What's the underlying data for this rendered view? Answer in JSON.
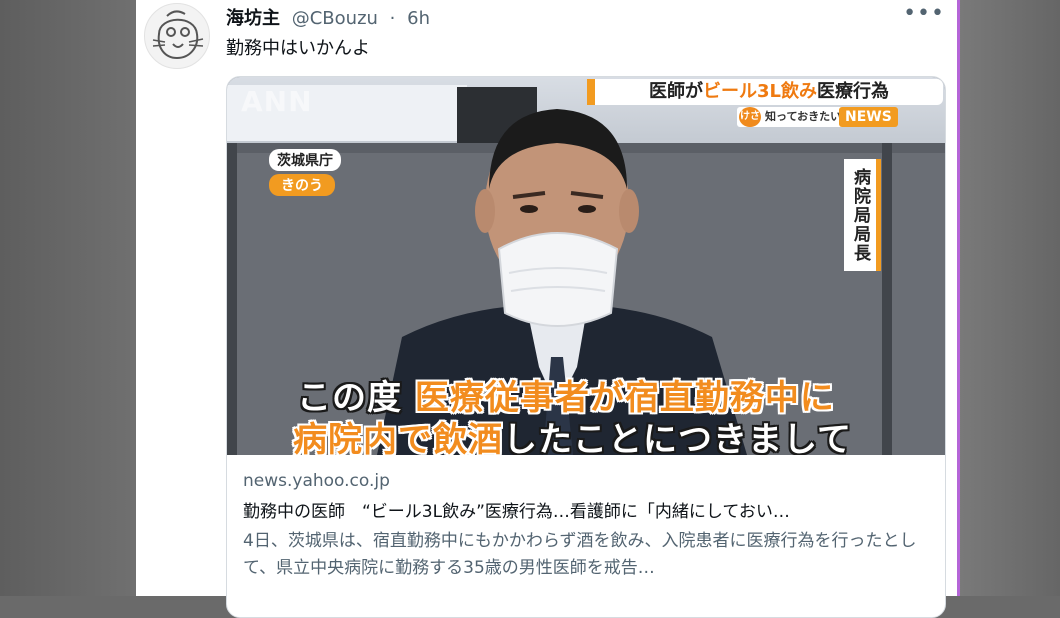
{
  "tweet": {
    "display_name": "海坊主",
    "handle": "@CBouzu",
    "separator": "·",
    "time": "6h",
    "more_label": "•••",
    "text": "勤務中はいかんよ"
  },
  "media": {
    "banner_prefix": "医師が",
    "banner_highlight": "ビール3L飲み",
    "banner_suffix": "医療行為",
    "show_logo_mark": "けさ",
    "show_logo_text": "知っておきたい!",
    "news_tag": "NEWS",
    "watermark": "ANN",
    "location": "茨城県庁",
    "when": "きのう",
    "role": "病院局局長",
    "caption_line1_white": "この度",
    "caption_line1_orange": "医療従事者が宿直勤務中に",
    "caption_line2_orange": "病院内で飲酒",
    "caption_line2_white": "したことにつきまして"
  },
  "link": {
    "domain": "news.yahoo.co.jp",
    "title": "勤務中の医師　“ビール3L飲み”医療行為…看護師に「内緒にしておい…",
    "description": "4日、茨城県は、宿直勤務中にもかかわらず酒を飲み、入院患者に医療行為を行ったとして、県立中央病院に勤務する35歳の男性医師を戒告…"
  },
  "colors": {
    "accent_orange": "#f29b20",
    "caption_orange": "#f28c1e",
    "text_primary": "#0f1419",
    "text_secondary": "#536471"
  }
}
